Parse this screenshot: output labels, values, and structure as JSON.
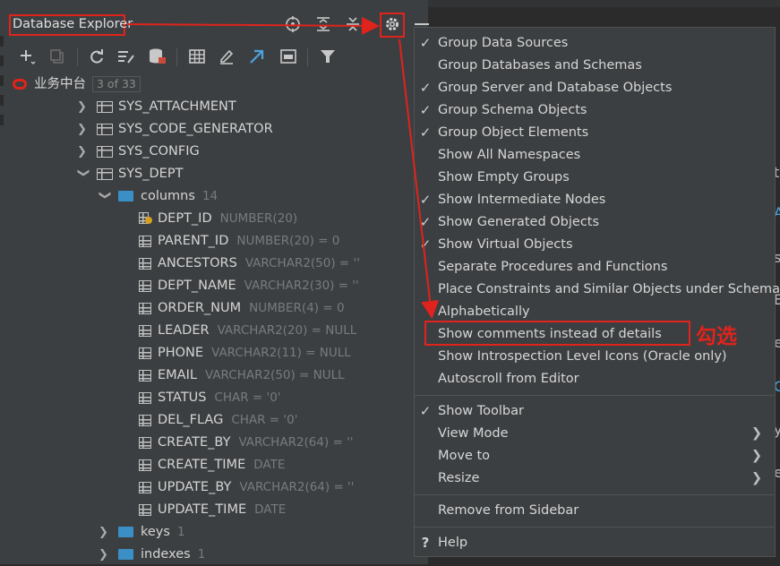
{
  "panel": {
    "title": "Database Explorer",
    "header_icons": [
      "crosshair-icon",
      "expand-all-icon",
      "collapse-all-icon",
      "gear-icon",
      "hide-icon"
    ]
  },
  "toolbar": {
    "icons": [
      "add-icon",
      "duplicate-icon",
      "refresh-icon",
      "sync-schema-icon",
      "database-settings-icon",
      "table-view-icon",
      "edit-icon",
      "jump-to-source-icon",
      "sql-console-icon",
      "filter-icon"
    ]
  },
  "tree": {
    "datasource": {
      "label": "业务中台",
      "badge": "3 of 33"
    },
    "tables": [
      "SYS_ATTACHMENT",
      "SYS_CODE_GENERATOR",
      "SYS_CONFIG",
      "SYS_DEPT"
    ],
    "columns_folder": {
      "label": "columns",
      "count": "14"
    },
    "columns": [
      {
        "name": "DEPT_ID",
        "type": "NUMBER(20)"
      },
      {
        "name": "PARENT_ID",
        "type": "NUMBER(20) = 0"
      },
      {
        "name": "ANCESTORS",
        "type": "VARCHAR2(50) = ''"
      },
      {
        "name": "DEPT_NAME",
        "type": "VARCHAR2(30) = ''"
      },
      {
        "name": "ORDER_NUM",
        "type": "NUMBER(4) = 0"
      },
      {
        "name": "LEADER",
        "type": "VARCHAR2(20) = NULL"
      },
      {
        "name": "PHONE",
        "type": "VARCHAR2(11) = NULL"
      },
      {
        "name": "EMAIL",
        "type": "VARCHAR2(50) = NULL"
      },
      {
        "name": "STATUS",
        "type": "CHAR = '0'"
      },
      {
        "name": "DEL_FLAG",
        "type": "CHAR = '0'"
      },
      {
        "name": "CREATE_BY",
        "type": "VARCHAR2(64) = ''"
      },
      {
        "name": "CREATE_TIME",
        "type": "DATE"
      },
      {
        "name": "UPDATE_BY",
        "type": "VARCHAR2(64) = ''"
      },
      {
        "name": "UPDATE_TIME",
        "type": "DATE"
      }
    ],
    "keys": {
      "label": "keys",
      "count": "1"
    },
    "indexes": {
      "label": "indexes",
      "count": "1"
    }
  },
  "menu": {
    "items": [
      {
        "label": "Group Data Sources",
        "checked": true
      },
      {
        "label": "Group Databases and Schemas",
        "checked": false
      },
      {
        "label": "Group Server and Database Objects",
        "checked": true
      },
      {
        "label": "Group Schema Objects",
        "checked": true
      },
      {
        "label": "Group Object Elements",
        "checked": true
      },
      {
        "label": "Show All Namespaces",
        "checked": false
      },
      {
        "label": "Show Empty Groups",
        "checked": false
      },
      {
        "label": "Show Intermediate Nodes",
        "checked": true
      },
      {
        "label": "Show Generated Objects",
        "checked": true
      },
      {
        "label": "Show Virtual Objects",
        "checked": true
      },
      {
        "label": "Separate Procedures and Functions",
        "checked": false
      },
      {
        "label": "Place Constraints and Similar Objects under Schema",
        "checked": false
      },
      {
        "label": "Alphabetically",
        "checked": false
      },
      {
        "label": "Show comments instead of details",
        "checked": false
      },
      {
        "label": "Show Introspection Level Icons (Oracle only)",
        "checked": false
      },
      {
        "label": "Autoscroll from Editor",
        "checked": false
      }
    ],
    "items2": [
      {
        "label": "Show Toolbar",
        "checked": true,
        "submenu": false
      },
      {
        "label": "View Mode",
        "checked": false,
        "submenu": true
      },
      {
        "label": "Move to",
        "checked": false,
        "submenu": true
      },
      {
        "label": "Resize",
        "checked": false,
        "submenu": true
      }
    ],
    "remove_label": "Remove from Sidebar",
    "help_label": "Help"
  },
  "annotation": {
    "text": "勾选",
    "color": "#e0231c"
  },
  "colors": {
    "panel_bg": "#3c3f41",
    "editor_bg": "#2b2b2b",
    "folder": "#3b8fc7",
    "accent_red": "#e0231c"
  }
}
